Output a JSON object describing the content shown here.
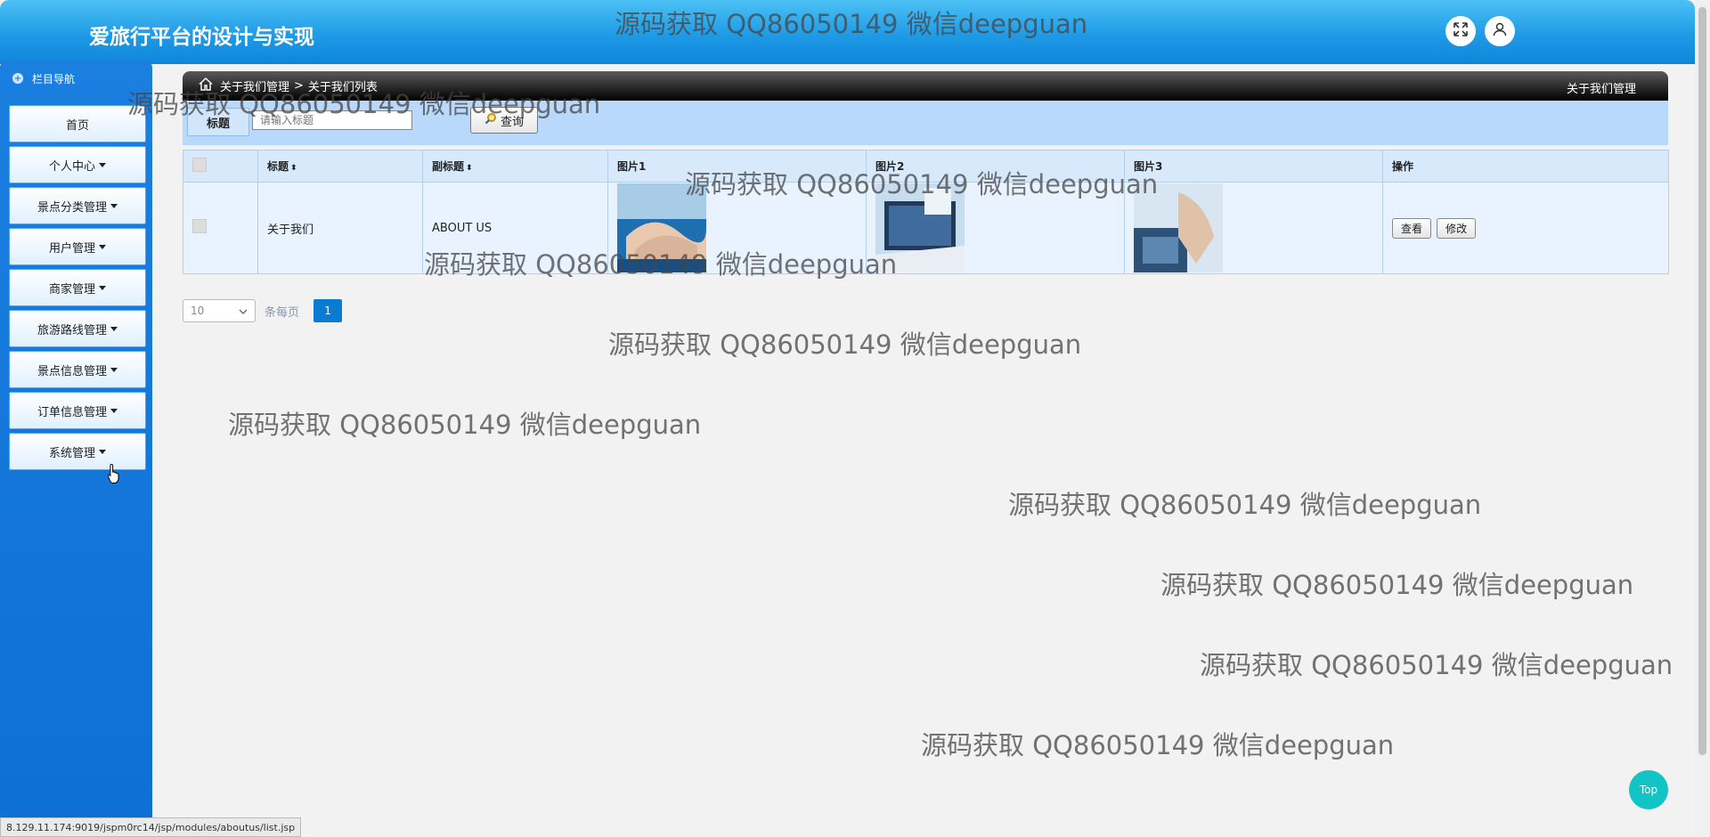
{
  "header": {
    "title": "爱旅行平台的设计与实现"
  },
  "sidebar": {
    "title": "栏目导航",
    "items": [
      {
        "label": "首页",
        "has_caret": false
      },
      {
        "label": "个人中心",
        "has_caret": true
      },
      {
        "label": "景点分类管理",
        "has_caret": true
      },
      {
        "label": "用户管理",
        "has_caret": true
      },
      {
        "label": "商家管理",
        "has_caret": true
      },
      {
        "label": "旅游路线管理",
        "has_caret": true
      },
      {
        "label": "景点信息管理",
        "has_caret": true
      },
      {
        "label": "订单信息管理",
        "has_caret": true
      },
      {
        "label": "系统管理",
        "has_caret": true
      }
    ]
  },
  "breadcrumb": {
    "level1": "关于我们管理",
    "separator": ">",
    "level2": "关于我们列表",
    "right_title": "关于我们管理"
  },
  "search": {
    "label": "标题",
    "placeholder": "请输入标题",
    "button": "查询"
  },
  "table": {
    "columns": [
      "标题",
      "副标题",
      "图片1",
      "图片2",
      "图片3",
      "操作"
    ],
    "rows": [
      {
        "title": "关于我们",
        "subtitle": "ABOUT US",
        "view": "查看",
        "edit": "修改"
      }
    ]
  },
  "pager": {
    "page_size": "10",
    "page_size_label": "条每页",
    "current_page": "1"
  },
  "top_button": "Top",
  "status_url": "8.129.11.174:9019/jspm0rc14/jsp/modules/aboutus/list.jsp",
  "watermark": "源码获取 QQ86050149 微信deepguan",
  "colors": {
    "header": "#1f9ae6",
    "sidebar": "#1b7fe0",
    "page_button": "#0a7bd3",
    "top_button": "#13c4c4"
  }
}
